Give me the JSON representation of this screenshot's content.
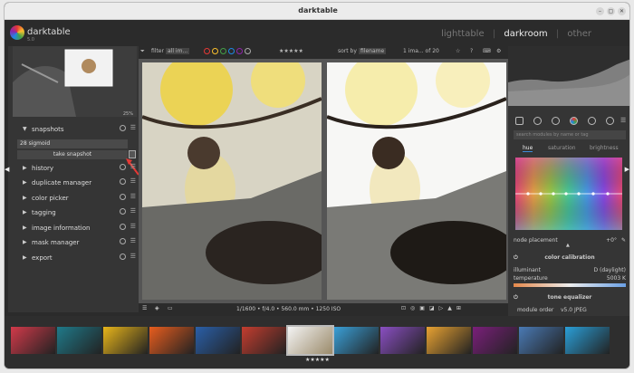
{
  "window": {
    "title": "darktable"
  },
  "header": {
    "app_name": "darktable",
    "app_version": "5.0",
    "views": [
      "lighttable",
      "darkroom",
      "other"
    ],
    "active_view": "darkroom"
  },
  "toolbar": {
    "filter_label": "filter",
    "filter_value": "all im...",
    "sort_label": "sort by",
    "sort_value": "filename",
    "count": "1 ima... of 20",
    "rating": "★★★★★"
  },
  "navigation": {
    "zoom": "25%"
  },
  "left_modules": [
    {
      "label": "snapshots",
      "expanded": true
    },
    {
      "label": "history",
      "expanded": false
    },
    {
      "label": "duplicate manager",
      "expanded": false
    },
    {
      "label": "color picker",
      "expanded": false
    },
    {
      "label": "tagging",
      "expanded": false
    },
    {
      "label": "image information",
      "expanded": false
    },
    {
      "label": "mask manager",
      "expanded": false
    },
    {
      "label": "export",
      "expanded": false
    }
  ],
  "snapshots": {
    "entry_number": "28",
    "entry_label": "sigmoid",
    "take_button": "take snapshot"
  },
  "image_info": {
    "exif": "1/1600 • f/4.0 • 560.0 mm • 1250 ISO"
  },
  "right_panel": {
    "search_placeholder": "search modules by name or tag",
    "tabs": [
      "hue",
      "saturation",
      "brightness"
    ],
    "active_tab": "hue",
    "node_placement_label": "node placement",
    "node_placement_value": "+0°",
    "color_calibration": {
      "title": "color calibration",
      "illuminant_label": "illuminant",
      "illuminant_value": "D (daylight)",
      "temperature_label": "temperature",
      "temperature_value": "5003 K"
    },
    "tone_equalizer": "tone equalizer",
    "module_order_label": "module order",
    "module_order_value": "v5.0 JPEG"
  },
  "filmstrip": {
    "selected_rating": "★★★★★",
    "thumb_colors": [
      "#d23a4a",
      "#1f7a8a",
      "#e8b51a",
      "#e85d1e",
      "#2a5fa8",
      "#c43d2f",
      "#e7e7e7",
      "#3aa0d8",
      "#8a4fc2",
      "#e8a232",
      "#7a1f7a",
      "#4a7ab5",
      "#2a9fd8"
    ]
  }
}
